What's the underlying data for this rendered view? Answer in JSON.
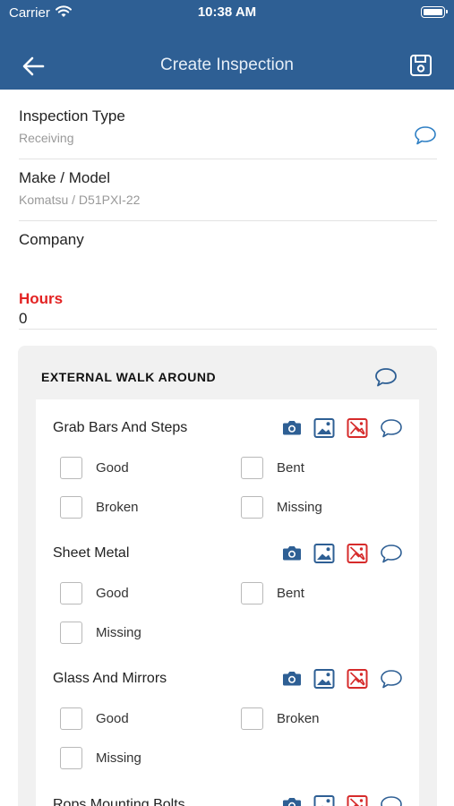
{
  "status": {
    "carrier": "Carrier",
    "time": "10:38 AM"
  },
  "nav": {
    "title": "Create Inspection"
  },
  "fields": {
    "inspection_type": {
      "label": "Inspection Type",
      "value": "Receiving"
    },
    "make_model": {
      "label": "Make / Model",
      "value": "Komatsu / D51PXI-22"
    },
    "company": {
      "label": "Company",
      "value": ""
    },
    "hours": {
      "label": "Hours",
      "value": "0"
    }
  },
  "section": {
    "title": "EXTERNAL WALK AROUND",
    "items": [
      {
        "title": "Grab Bars And Steps",
        "options": [
          "Good",
          "Bent",
          "Broken",
          "Missing"
        ]
      },
      {
        "title": "Sheet Metal",
        "options": [
          "Good",
          "Bent",
          "Missing"
        ]
      },
      {
        "title": "Glass And Mirrors",
        "options": [
          "Good",
          "Broken",
          "Missing"
        ]
      },
      {
        "title": "Rops Mounting Bolts",
        "options": []
      }
    ]
  },
  "colors": {
    "header": "#2e5f94",
    "accent_blue": "#2e5f94",
    "comment_blue": "#2e7fc4",
    "delete_red": "#d62b2b",
    "required_red": "#e32222"
  },
  "icons": {
    "back": "arrow-left-icon",
    "save": "floppy-disk-icon",
    "comment": "speech-bubble-icon",
    "camera": "camera-icon",
    "gallery": "image-gallery-icon",
    "remove_image": "remove-image-icon"
  }
}
